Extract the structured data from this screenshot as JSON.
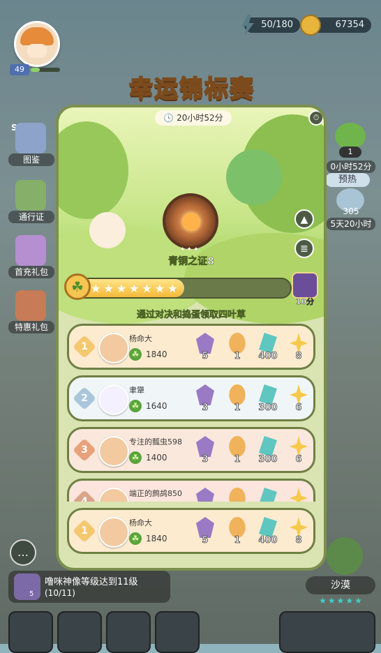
{
  "hud": {
    "level": "49",
    "energy": "50/180",
    "gold": "67354",
    "energy_icon": "bolt-icon",
    "gold_icon": "coin-icon"
  },
  "left_menu": [
    {
      "badge": "S1",
      "label": "图鉴",
      "icon": "book-icon"
    },
    {
      "label": "通行证",
      "icon": "pass-icon"
    },
    {
      "label": "首充礼包",
      "icon": "gift-icon"
    },
    {
      "label": "特惠礼包",
      "icon": "chest-icon"
    }
  ],
  "right_menu": {
    "clover_count": "1",
    "clover_timer": "0小时52分",
    "preheat_label": "预热",
    "counter": "305",
    "counter_timer": "5天20小时"
  },
  "event": {
    "title": "幸运锦标赛",
    "timer": "20小时52分",
    "medal_name": "青铜之证8",
    "progress": 0.52,
    "prize_label": "10分",
    "hint": "通过对决和捣蛋领取四叶草"
  },
  "leaderboard": [
    {
      "rank": "1",
      "name": "杨命大",
      "score": "1840",
      "rewards": [
        "5",
        "1",
        "400",
        "8"
      ],
      "rank_color": "#f5c870",
      "bg": "#fdebd0"
    },
    {
      "rank": "2",
      "name": "聿犟",
      "score": "1640",
      "rewards": [
        "3",
        "1",
        "300",
        "6"
      ],
      "rank_color": "#a9c6db",
      "bg": "#f0f6f8"
    },
    {
      "rank": "3",
      "name": "专注的瓢虫598",
      "score": "1400",
      "rewards": [
        "3",
        "1",
        "300",
        "6"
      ],
      "rank_color": "#e8a17a",
      "bg": "#fbe8dc"
    },
    {
      "rank": "4",
      "name": "端正的鹧鸪850",
      "score": "",
      "rewards": [
        "",
        "",
        "",
        ""
      ],
      "rank_color": "#d9a58a",
      "bg": "#fbe5dc"
    }
  ],
  "self_entry": {
    "rank": "1",
    "name": "杨命大",
    "score": "1840",
    "rewards": [
      "5",
      "1",
      "400",
      "8"
    ]
  },
  "quest": {
    "text": "噜咪神像等级达到11级",
    "progress": "(10/11)",
    "count": "5"
  },
  "desert": {
    "label": "沙漠",
    "stars": "★★★★★"
  },
  "colors": {
    "panel_bg": "#d9e4b2",
    "panel_border": "#7c8f4e",
    "progress_fill": "#f3b93a",
    "title_fill": "#fff4cc",
    "title_stroke": "#7b4b1e"
  }
}
